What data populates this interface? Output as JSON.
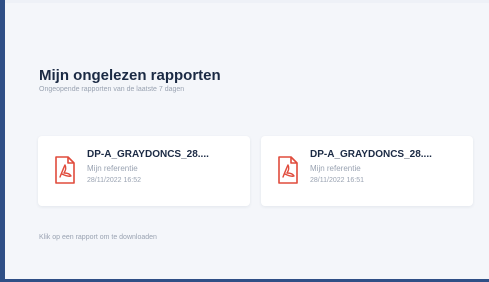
{
  "section": {
    "title": "Mijn ongelezen rapporten",
    "subtitle": "Ongeopende rapporten van de laatste 7 dagen"
  },
  "reports": [
    {
      "file_name": "DP-A_GRAYDONCS_28....",
      "reference": "Mijn referentie",
      "date": "28/11/2022 16:52",
      "icon": "pdf-file-icon"
    },
    {
      "file_name": "DP-A_GRAYDONCS_28....",
      "reference": "Mijn referentie",
      "date": "28/11/2022 16:51",
      "icon": "pdf-file-icon"
    }
  ],
  "footer": {
    "hint": "Klik op een rapport om te downloaden"
  },
  "colors": {
    "accent": "#2f4f86",
    "pdf_red": "#e04b3c",
    "text_dark": "#1b2a44",
    "text_muted": "#9aa3b2",
    "panel_bg": "#f4f6fa"
  }
}
